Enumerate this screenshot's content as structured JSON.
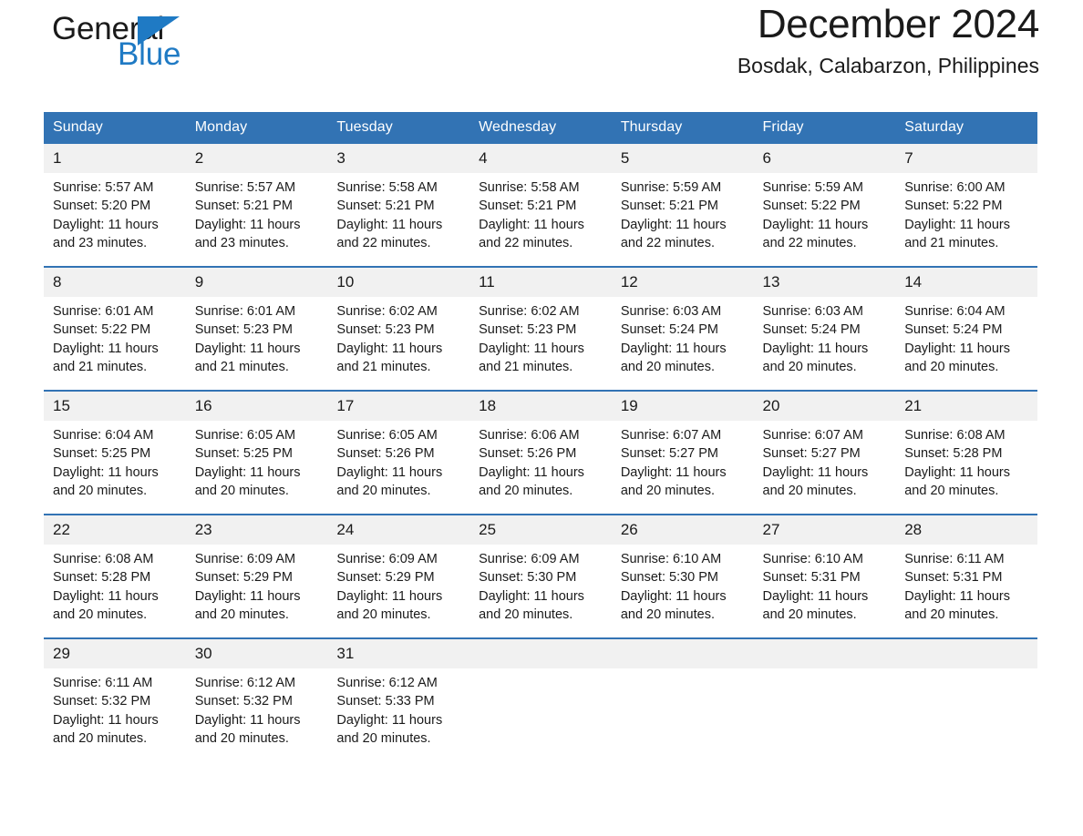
{
  "brand": {
    "name_part1": "General",
    "name_part2": "Blue",
    "triangle_color": "#1f7ac4",
    "accent_color": "#3273b4"
  },
  "header": {
    "title": "December 2024",
    "subtitle": "Bosdak, Calabarzon, Philippines"
  },
  "weekdays": [
    "Sunday",
    "Monday",
    "Tuesday",
    "Wednesday",
    "Thursday",
    "Friday",
    "Saturday"
  ],
  "weeks": [
    [
      {
        "day": "1",
        "sunrise": "Sunrise: 5:57 AM",
        "sunset": "Sunset: 5:20 PM",
        "daylight": "Daylight: 11 hours and 23 minutes."
      },
      {
        "day": "2",
        "sunrise": "Sunrise: 5:57 AM",
        "sunset": "Sunset: 5:21 PM",
        "daylight": "Daylight: 11 hours and 23 minutes."
      },
      {
        "day": "3",
        "sunrise": "Sunrise: 5:58 AM",
        "sunset": "Sunset: 5:21 PM",
        "daylight": "Daylight: 11 hours and 22 minutes."
      },
      {
        "day": "4",
        "sunrise": "Sunrise: 5:58 AM",
        "sunset": "Sunset: 5:21 PM",
        "daylight": "Daylight: 11 hours and 22 minutes."
      },
      {
        "day": "5",
        "sunrise": "Sunrise: 5:59 AM",
        "sunset": "Sunset: 5:21 PM",
        "daylight": "Daylight: 11 hours and 22 minutes."
      },
      {
        "day": "6",
        "sunrise": "Sunrise: 5:59 AM",
        "sunset": "Sunset: 5:22 PM",
        "daylight": "Daylight: 11 hours and 22 minutes."
      },
      {
        "day": "7",
        "sunrise": "Sunrise: 6:00 AM",
        "sunset": "Sunset: 5:22 PM",
        "daylight": "Daylight: 11 hours and 21 minutes."
      }
    ],
    [
      {
        "day": "8",
        "sunrise": "Sunrise: 6:01 AM",
        "sunset": "Sunset: 5:22 PM",
        "daylight": "Daylight: 11 hours and 21 minutes."
      },
      {
        "day": "9",
        "sunrise": "Sunrise: 6:01 AM",
        "sunset": "Sunset: 5:23 PM",
        "daylight": "Daylight: 11 hours and 21 minutes."
      },
      {
        "day": "10",
        "sunrise": "Sunrise: 6:02 AM",
        "sunset": "Sunset: 5:23 PM",
        "daylight": "Daylight: 11 hours and 21 minutes."
      },
      {
        "day": "11",
        "sunrise": "Sunrise: 6:02 AM",
        "sunset": "Sunset: 5:23 PM",
        "daylight": "Daylight: 11 hours and 21 minutes."
      },
      {
        "day": "12",
        "sunrise": "Sunrise: 6:03 AM",
        "sunset": "Sunset: 5:24 PM",
        "daylight": "Daylight: 11 hours and 20 minutes."
      },
      {
        "day": "13",
        "sunrise": "Sunrise: 6:03 AM",
        "sunset": "Sunset: 5:24 PM",
        "daylight": "Daylight: 11 hours and 20 minutes."
      },
      {
        "day": "14",
        "sunrise": "Sunrise: 6:04 AM",
        "sunset": "Sunset: 5:24 PM",
        "daylight": "Daylight: 11 hours and 20 minutes."
      }
    ],
    [
      {
        "day": "15",
        "sunrise": "Sunrise: 6:04 AM",
        "sunset": "Sunset: 5:25 PM",
        "daylight": "Daylight: 11 hours and 20 minutes."
      },
      {
        "day": "16",
        "sunrise": "Sunrise: 6:05 AM",
        "sunset": "Sunset: 5:25 PM",
        "daylight": "Daylight: 11 hours and 20 minutes."
      },
      {
        "day": "17",
        "sunrise": "Sunrise: 6:05 AM",
        "sunset": "Sunset: 5:26 PM",
        "daylight": "Daylight: 11 hours and 20 minutes."
      },
      {
        "day": "18",
        "sunrise": "Sunrise: 6:06 AM",
        "sunset": "Sunset: 5:26 PM",
        "daylight": "Daylight: 11 hours and 20 minutes."
      },
      {
        "day": "19",
        "sunrise": "Sunrise: 6:07 AM",
        "sunset": "Sunset: 5:27 PM",
        "daylight": "Daylight: 11 hours and 20 minutes."
      },
      {
        "day": "20",
        "sunrise": "Sunrise: 6:07 AM",
        "sunset": "Sunset: 5:27 PM",
        "daylight": "Daylight: 11 hours and 20 minutes."
      },
      {
        "day": "21",
        "sunrise": "Sunrise: 6:08 AM",
        "sunset": "Sunset: 5:28 PM",
        "daylight": "Daylight: 11 hours and 20 minutes."
      }
    ],
    [
      {
        "day": "22",
        "sunrise": "Sunrise: 6:08 AM",
        "sunset": "Sunset: 5:28 PM",
        "daylight": "Daylight: 11 hours and 20 minutes."
      },
      {
        "day": "23",
        "sunrise": "Sunrise: 6:09 AM",
        "sunset": "Sunset: 5:29 PM",
        "daylight": "Daylight: 11 hours and 20 minutes."
      },
      {
        "day": "24",
        "sunrise": "Sunrise: 6:09 AM",
        "sunset": "Sunset: 5:29 PM",
        "daylight": "Daylight: 11 hours and 20 minutes."
      },
      {
        "day": "25",
        "sunrise": "Sunrise: 6:09 AM",
        "sunset": "Sunset: 5:30 PM",
        "daylight": "Daylight: 11 hours and 20 minutes."
      },
      {
        "day": "26",
        "sunrise": "Sunrise: 6:10 AM",
        "sunset": "Sunset: 5:30 PM",
        "daylight": "Daylight: 11 hours and 20 minutes."
      },
      {
        "day": "27",
        "sunrise": "Sunrise: 6:10 AM",
        "sunset": "Sunset: 5:31 PM",
        "daylight": "Daylight: 11 hours and 20 minutes."
      },
      {
        "day": "28",
        "sunrise": "Sunrise: 6:11 AM",
        "sunset": "Sunset: 5:31 PM",
        "daylight": "Daylight: 11 hours and 20 minutes."
      }
    ],
    [
      {
        "day": "29",
        "sunrise": "Sunrise: 6:11 AM",
        "sunset": "Sunset: 5:32 PM",
        "daylight": "Daylight: 11 hours and 20 minutes."
      },
      {
        "day": "30",
        "sunrise": "Sunrise: 6:12 AM",
        "sunset": "Sunset: 5:32 PM",
        "daylight": "Daylight: 11 hours and 20 minutes."
      },
      {
        "day": "31",
        "sunrise": "Sunrise: 6:12 AM",
        "sunset": "Sunset: 5:33 PM",
        "daylight": "Daylight: 11 hours and 20 minutes."
      },
      {
        "day": "",
        "sunrise": "",
        "sunset": "",
        "daylight": ""
      },
      {
        "day": "",
        "sunrise": "",
        "sunset": "",
        "daylight": ""
      },
      {
        "day": "",
        "sunrise": "",
        "sunset": "",
        "daylight": ""
      },
      {
        "day": "",
        "sunrise": "",
        "sunset": "",
        "daylight": ""
      }
    ]
  ]
}
